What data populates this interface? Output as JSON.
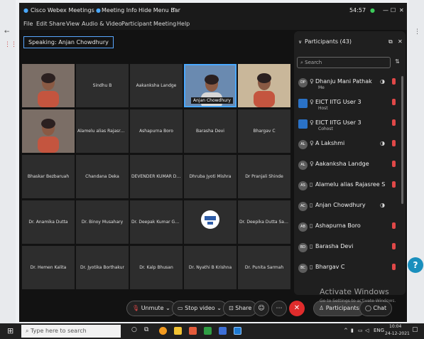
{
  "titlebar": {
    "app_title": "Cisco Webex Meetings",
    "meeting_info": "Meeting Info",
    "hide_menu": "Hide Menu Bar",
    "timer": "54:57"
  },
  "menubar": {
    "items": [
      "File",
      "Edit",
      "Share",
      "View",
      "Audio & Video",
      "Participant",
      "Meeting",
      "Help"
    ]
  },
  "speaking": "Speaking: Anjan Chowdhury",
  "tiles": [
    {
      "label": ""
    },
    {
      "label": "Sindhu B"
    },
    {
      "label": "Aakanksha Landge"
    },
    {
      "label": "Anjan Chowdhury"
    },
    {
      "label": ""
    },
    {
      "label": ""
    },
    {
      "label": "Alamelu alias Rajasree S"
    },
    {
      "label": "Ashapurna Boro"
    },
    {
      "label": "Barasha Devi"
    },
    {
      "label": "Bhargav C"
    },
    {
      "label": "Bhaskar Bezbaruah"
    },
    {
      "label": "Chandana Deka"
    },
    {
      "label": "DEVENDER KUMAR DHAKED"
    },
    {
      "label": "Dhruba Jyoti Mishra"
    },
    {
      "label": "Dr Pranjali Shinde"
    },
    {
      "label": "Dr. Anamika Dutta"
    },
    {
      "label": "Dr. Binoy Musahary"
    },
    {
      "label": "Dr. Deepak Kumar Gogoi"
    },
    {
      "label": ""
    },
    {
      "label": "Dr. Deepika Dutta Saikia"
    },
    {
      "label": "Dr. Hemen Kalita"
    },
    {
      "label": "Dr. Jyotika Borthakur"
    },
    {
      "label": "Dr. Kalp Bhusan"
    },
    {
      "label": "Dr. Nyathi B Krishna"
    },
    {
      "label": "Dr. Punita Sarmah"
    }
  ],
  "participants": {
    "title": "Participants (43)",
    "search_placeholder": "Search",
    "list": [
      {
        "initials": "DP",
        "name": "Dhanju Mani Pathak",
        "role": "Me"
      },
      {
        "initials": "",
        "name": "EICT IITG User 3",
        "role": "Host"
      },
      {
        "initials": "",
        "name": "EICT IITG User 3",
        "role": "Cohost"
      },
      {
        "initials": "AL",
        "name": "A Lakshmi",
        "role": ""
      },
      {
        "initials": "AL",
        "name": "Aakanksha Landge",
        "role": ""
      },
      {
        "initials": "AS",
        "name": "Alamelu alias Rajasree S",
        "role": ""
      },
      {
        "initials": "AC",
        "name": "Anjan Chowdhury",
        "role": ""
      },
      {
        "initials": "AB",
        "name": "Ashapurna Boro",
        "role": ""
      },
      {
        "initials": "BD",
        "name": "Barasha Devi",
        "role": ""
      },
      {
        "initials": "BC",
        "name": "Bhargav C",
        "role": ""
      }
    ]
  },
  "toolbar": {
    "unmute": "Unmute",
    "stop_video": "Stop video",
    "share": "Share",
    "participants": "Participants",
    "chat": "Chat"
  },
  "watermark": {
    "line1": "Activate Windows",
    "line2": "Go to Settings to activate Windows."
  },
  "taskbar": {
    "search_placeholder": "Type here to search",
    "lang": "ENG",
    "time": "10:04",
    "date": "24-12-2021"
  },
  "colors": {
    "accent": "#4aa8ff",
    "end_call": "#e02c2c",
    "muted_mic": "#e04848"
  }
}
